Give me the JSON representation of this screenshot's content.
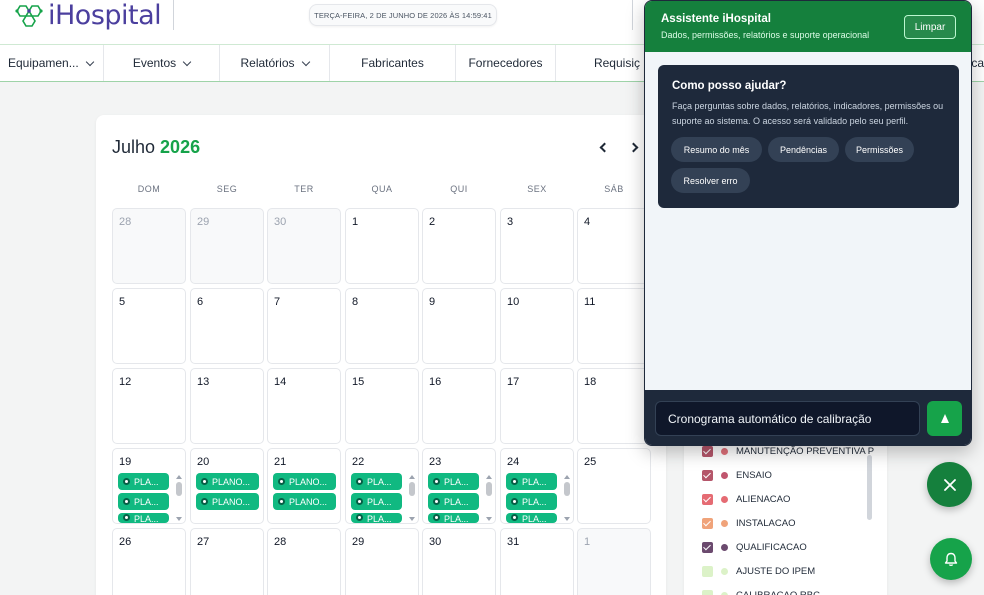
{
  "app": {
    "logo_text": "iHospital",
    "datetime": "TERÇA-FEIRA, 2 DE JUNHO DE 2026 ÀS 14:59:41"
  },
  "nav": {
    "items": [
      {
        "label": "Equipamen...",
        "dropdown": true
      },
      {
        "label": "Eventos",
        "dropdown": true
      },
      {
        "label": "Relatórios",
        "dropdown": true
      },
      {
        "label": "Fabricantes",
        "dropdown": false
      },
      {
        "label": "Fornecedores",
        "dropdown": false
      },
      {
        "label": "Requisiç",
        "dropdown": false
      },
      {
        "label": "ca",
        "dropdown": false
      }
    ]
  },
  "calendar": {
    "month": "Julho",
    "year": "2026",
    "weekdays": [
      "DOM",
      "SEG",
      "TER",
      "QUA",
      "QUI",
      "SEX",
      "SÁB"
    ],
    "weeks": [
      [
        {
          "n": "28",
          "other": true
        },
        {
          "n": "29",
          "other": true
        },
        {
          "n": "30",
          "other": true
        },
        {
          "n": "1"
        },
        {
          "n": "2"
        },
        {
          "n": "3"
        },
        {
          "n": "4"
        }
      ],
      [
        {
          "n": "5"
        },
        {
          "n": "6"
        },
        {
          "n": "7"
        },
        {
          "n": "8"
        },
        {
          "n": "9"
        },
        {
          "n": "10"
        },
        {
          "n": "11"
        }
      ],
      [
        {
          "n": "12"
        },
        {
          "n": "13"
        },
        {
          "n": "14"
        },
        {
          "n": "15"
        },
        {
          "n": "16"
        },
        {
          "n": "17"
        },
        {
          "n": "18"
        }
      ],
      [
        {
          "n": "19",
          "events": [
            "PLA...",
            "PLA...",
            "PLA..."
          ],
          "scroll": true
        },
        {
          "n": "20",
          "events": [
            "PLANO...",
            "PLANO..."
          ]
        },
        {
          "n": "21",
          "events": [
            "PLANO...",
            "PLANO..."
          ]
        },
        {
          "n": "22",
          "events": [
            "PLA...",
            "PLA...",
            "PLA..."
          ],
          "scroll": true
        },
        {
          "n": "23",
          "events": [
            "PLA...",
            "PLA...",
            "PLA..."
          ],
          "scroll": true
        },
        {
          "n": "24",
          "events": [
            "PLA...",
            "PLA...",
            "PLA..."
          ],
          "scroll": true
        },
        {
          "n": "25"
        }
      ],
      [
        {
          "n": "26"
        },
        {
          "n": "27"
        },
        {
          "n": "28"
        },
        {
          "n": "29"
        },
        {
          "n": "30"
        },
        {
          "n": "31"
        },
        {
          "n": "1",
          "other": true
        }
      ]
    ]
  },
  "legend": {
    "items": [
      {
        "label": "MANUTENÇÃO PREVENTIVA P",
        "color": "#e0707a",
        "box": "#b5566a",
        "checked": true
      },
      {
        "label": "ENSAIO",
        "color": "#c0566e",
        "box": "#b5566a",
        "checked": true
      },
      {
        "label": "ALIENACAO",
        "color": "#e56b73",
        "box": "#e56b73",
        "checked": true
      },
      {
        "label": "INSTALACAO",
        "color": "#f0a37a",
        "box": "#f0a37a",
        "checked": true
      },
      {
        "label": "QUALIFICACAO",
        "color": "#6b4a6e",
        "box": "#6b4a6e",
        "checked": true
      },
      {
        "label": "AJUSTE DO IPEM",
        "color": "#dcf2c8",
        "box": "#dcf2c8",
        "checked": false
      },
      {
        "label": "CALIBRACAO RBC",
        "color": "#dcf2c8",
        "box": "#dcf2c8",
        "checked": false
      }
    ]
  },
  "assistant": {
    "title": "Assistente iHospital",
    "subtitle": "Dados, permissões, relatórios e suporte operacional",
    "clear_label": "Limpar",
    "help_title": "Como posso ajudar?",
    "help_desc": "Faça perguntas sobre dados, relatórios, indicadores, permissões ou suporte ao sistema. O acesso será validado pelo seu perfil.",
    "chips": [
      "Resumo do mês",
      "Pendências",
      "Permissões",
      "Resolver erro"
    ],
    "input_value": "Cronograma automático de calibração"
  },
  "colors": {
    "brand_green": "#15803d",
    "event_green": "#10b981",
    "dark_panel": "#1e293b",
    "logo_purple": "#4b3f9e"
  },
  "icons": {
    "logo": "hexagon-molecule-icon",
    "close": "close-icon",
    "bell": "bell-icon",
    "send": "send-arrow-icon",
    "gear": "gear-icon"
  }
}
